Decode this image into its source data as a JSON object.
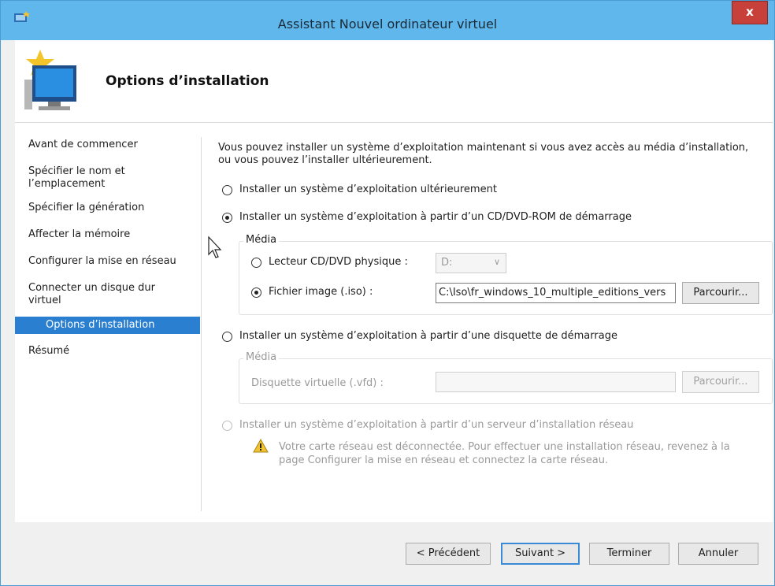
{
  "window": {
    "title": "Assistant Nouvel ordinateur virtuel",
    "close_label": "x"
  },
  "header": {
    "heading": "Options d’installation"
  },
  "nav": {
    "items": [
      {
        "label": "Avant de commencer"
      },
      {
        "label": "Spécifier le nom et l’emplacement"
      },
      {
        "label": "Spécifier la génération"
      },
      {
        "label": "Affecter la mémoire"
      },
      {
        "label": "Configurer la mise en réseau"
      },
      {
        "label": "Connecter un disque dur virtuel"
      },
      {
        "label": "Options d’installation",
        "active": true
      },
      {
        "label": "Résumé"
      }
    ]
  },
  "main": {
    "intro": "Vous pouvez installer un système d’exploitation maintenant si vous avez accès au média d’installation, ou vous pouvez l’installer ultérieurement.",
    "option_later": "Installer un système d’exploitation ultérieurement",
    "option_cd": "Installer un système d’exploitation à partir d’un CD/DVD-ROM de démarrage",
    "cd_group": {
      "legend": "Média",
      "physical_label": "Lecteur CD/DVD physique :",
      "physical_value": "D:",
      "iso_label": "Fichier image (.iso) :",
      "iso_value": "C:\\Iso\\fr_windows_10_multiple_editions_vers",
      "browse": "Parcourir..."
    },
    "option_floppy": "Installer un système d’exploitation à partir d’une disquette de démarrage",
    "floppy_group": {
      "legend": "Média",
      "vfd_label": "Disquette virtuelle (.vfd) :",
      "vfd_value": "",
      "browse": "Parcourir..."
    },
    "option_network": "Installer un système d’exploitation à partir d’un serveur d’installation réseau",
    "network_warning": "Votre carte réseau est déconnectée. Pour effectuer une installation réseau, revenez à la page Configurer la mise en réseau et connectez la carte réseau."
  },
  "footer": {
    "previous": "< Précédent",
    "next": "Suivant >",
    "finish": "Terminer",
    "cancel": "Annuler"
  }
}
